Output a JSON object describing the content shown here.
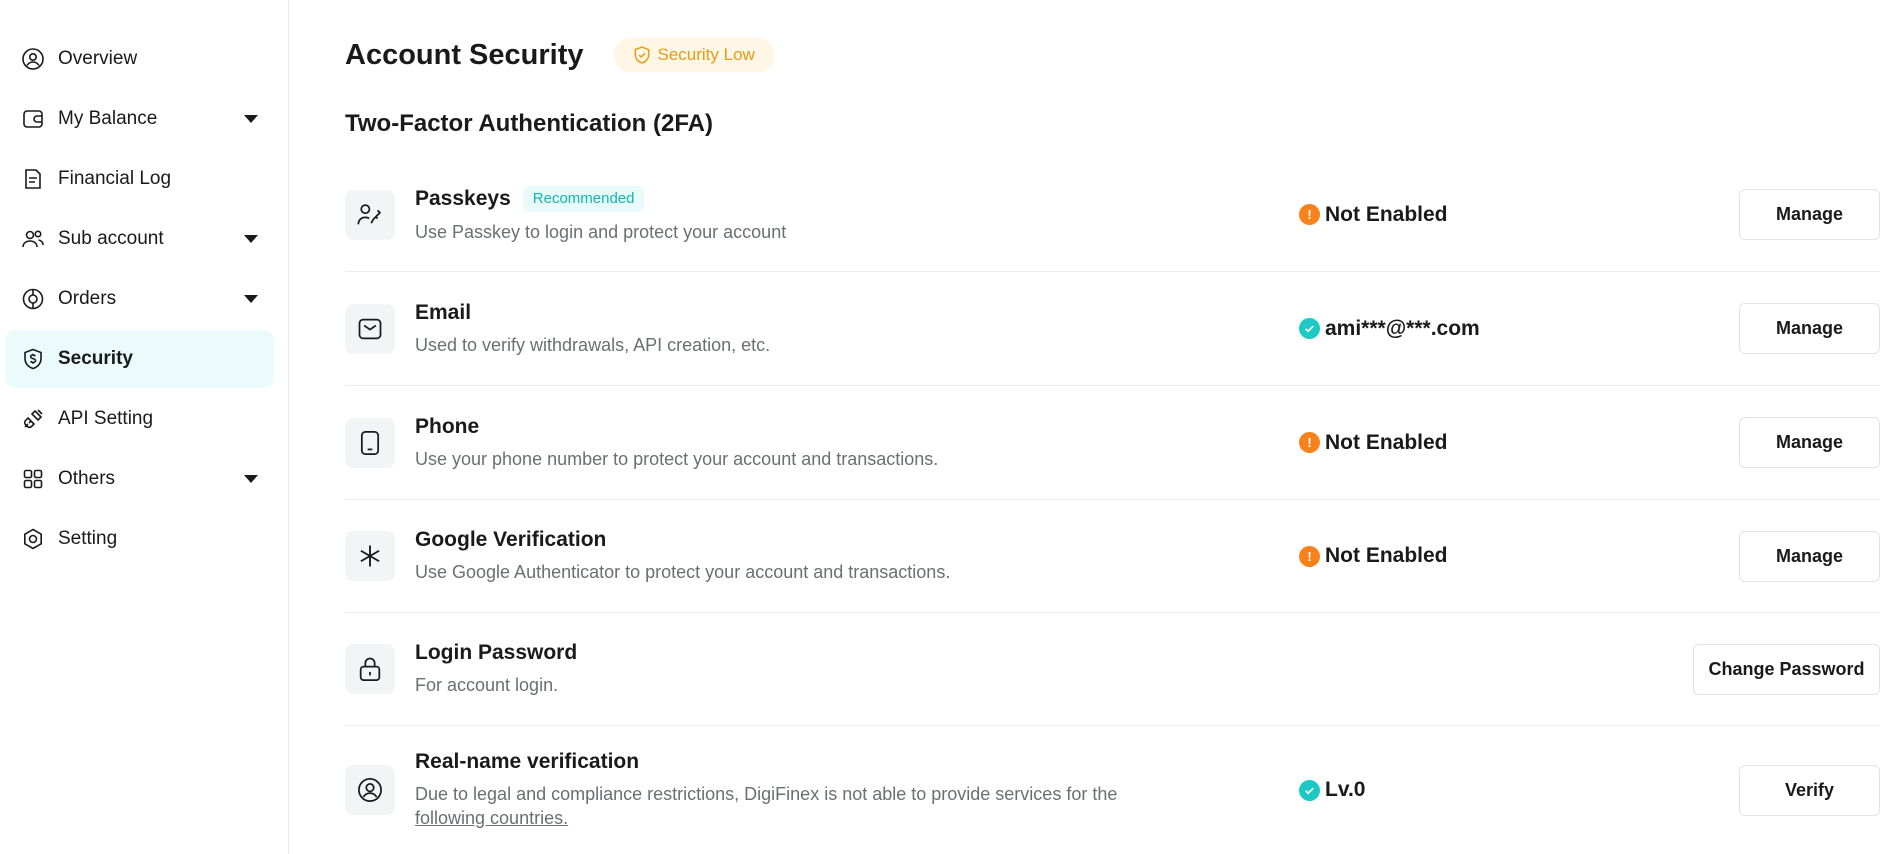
{
  "sidebar": {
    "items": [
      {
        "label": "Overview",
        "icon": "user-circle-icon",
        "has_caret": false,
        "active": false
      },
      {
        "label": "My Balance",
        "icon": "wallet-icon",
        "has_caret": true,
        "active": false
      },
      {
        "label": "Financial Log",
        "icon": "document-icon",
        "has_caret": false,
        "active": false
      },
      {
        "label": "Sub account",
        "icon": "users-icon",
        "has_caret": true,
        "active": false
      },
      {
        "label": "Orders",
        "icon": "orders-icon",
        "has_caret": true,
        "active": false
      },
      {
        "label": "Security",
        "icon": "shield-dollar-icon",
        "has_caret": false,
        "active": true
      },
      {
        "label": "API Setting",
        "icon": "api-plug-icon",
        "has_caret": false,
        "active": false
      },
      {
        "label": "Others",
        "icon": "grid-icon",
        "has_caret": true,
        "active": false
      },
      {
        "label": "Setting",
        "icon": "gear-icon",
        "has_caret": false,
        "active": false
      }
    ]
  },
  "header": {
    "title": "Account Security",
    "security_badge": "Security Low"
  },
  "section_title": "Two-Factor Authentication (2FA)",
  "rows": [
    {
      "title": "Passkeys",
      "badge": "Recommended",
      "desc": "Use Passkey to login and protect your account",
      "status": "Not Enabled",
      "status_type": "warn",
      "button": "Manage",
      "icon": "passkey-icon"
    },
    {
      "title": "Email",
      "desc": "Used to verify withdrawals, API creation, etc.",
      "status": "ami***@***.com",
      "status_type": "ok",
      "button": "Manage",
      "icon": "mail-icon"
    },
    {
      "title": "Phone",
      "desc": "Use your phone number to protect your account and transactions.",
      "status": "Not Enabled",
      "status_type": "warn",
      "button": "Manage",
      "icon": "phone-icon"
    },
    {
      "title": "Google Verification",
      "desc": "Use Google Authenticator to protect your account and transactions.",
      "status": "Not Enabled",
      "status_type": "warn",
      "button": "Manage",
      "icon": "authenticator-asterisk-icon"
    },
    {
      "title": "Login Password",
      "desc": "For account login.",
      "button": "Change Password",
      "icon": "lock-icon"
    },
    {
      "title": "Real-name verification",
      "desc": "Due to legal and compliance restrictions, DigiFinex is not able to provide services for the",
      "desc_link": "following countries.",
      "status": "Lv.0",
      "status_type": "ok",
      "button": "Verify",
      "icon": "user-id-icon"
    }
  ],
  "colors": {
    "accent": "#1cc9c4",
    "warning": "#f7821b",
    "security_low": "#e89b13",
    "active_nav_bg": "#ebfbfb"
  }
}
